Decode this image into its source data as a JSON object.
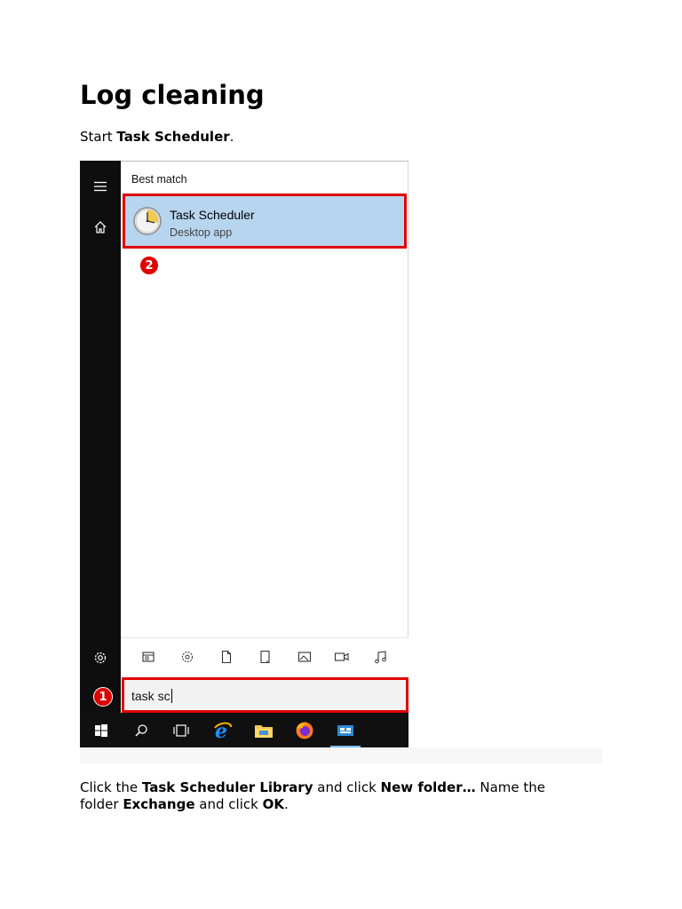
{
  "doc": {
    "title": "Log cleaning",
    "step1": {
      "pre": "Start ",
      "bold": "Task Scheduler",
      "post": "."
    },
    "step2": {
      "t1": "Click the ",
      "b1": "Task Scheduler Library",
      "t2": " and click ",
      "b2": "New folder…",
      "t3": " Name the folder ",
      "b3": "Exchange",
      "t4": " and click ",
      "b4": "OK",
      "t5": "."
    }
  },
  "start_menu": {
    "section_label": "Best match",
    "result": {
      "name": "Task Scheduler",
      "subtitle": "Desktop app",
      "icon": "task-scheduler-clock-icon"
    },
    "left_icons": [
      "hamburger-menu-icon",
      "home-icon",
      "settings-gear-icon"
    ],
    "filter_icons": [
      "apps-icon",
      "settings-icon",
      "documents-icon",
      "folders-icon",
      "photos-icon",
      "videos-icon",
      "music-icon"
    ],
    "search": {
      "value": "task sc"
    },
    "badges": {
      "search": "1",
      "result": "2"
    }
  },
  "taskbar": {
    "icons": [
      "windows-start-icon",
      "search-icon",
      "task-view-icon",
      "internet-explorer-icon",
      "file-explorer-icon",
      "firefox-icon",
      "server-manager-icon"
    ],
    "active": "server-manager-icon"
  },
  "colors": {
    "highlight_border": "#e00000",
    "result_background": "#b8d5ef",
    "sidebar": "#0e0e0e",
    "taskbar": "#101010"
  }
}
